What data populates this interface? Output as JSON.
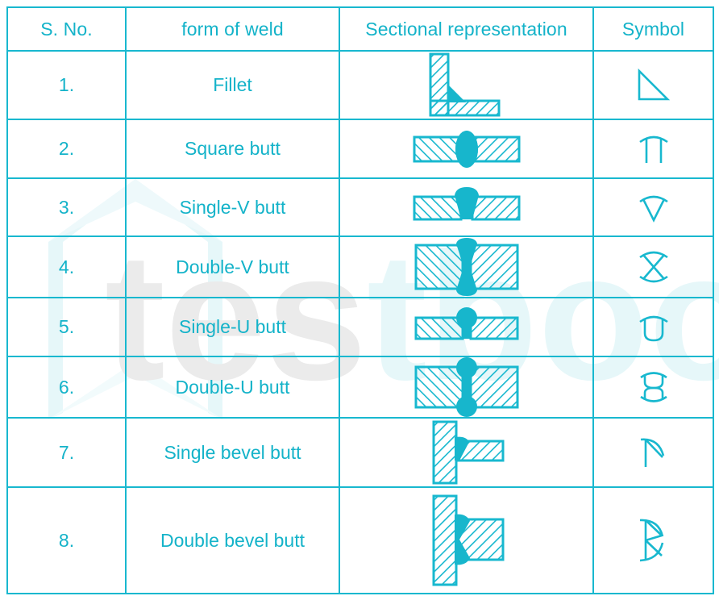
{
  "table": {
    "headers": [
      {
        "key": "sno",
        "label": "S. No."
      },
      {
        "key": "form",
        "label": "form of weld"
      },
      {
        "key": "sect",
        "label": "Sectional representation"
      },
      {
        "key": "sym",
        "label": "Symbol"
      }
    ],
    "rows": [
      {
        "sno": "1.",
        "form": "Fillet",
        "sectional": "fillet-weld-section",
        "symbol": "fillet-weld-symbol"
      },
      {
        "sno": "2.",
        "form": "Square butt",
        "sectional": "square-butt-section",
        "symbol": "square-butt-symbol"
      },
      {
        "sno": "3.",
        "form": "Single-V butt",
        "sectional": "single-v-butt-section",
        "symbol": "single-v-butt-symbol"
      },
      {
        "sno": "4.",
        "form": "Double-V butt",
        "sectional": "double-v-butt-section",
        "symbol": "double-v-butt-symbol"
      },
      {
        "sno": "5.",
        "form": "Single-U butt",
        "sectional": "single-u-butt-section",
        "symbol": "single-u-butt-symbol"
      },
      {
        "sno": "6.",
        "form": "Double-U butt",
        "sectional": "double-u-butt-section",
        "symbol": "double-u-butt-symbol"
      },
      {
        "sno": "7.",
        "form": "Single bevel butt",
        "sectional": "single-bevel-butt-section",
        "symbol": "single-bevel-butt-symbol"
      },
      {
        "sno": "8.",
        "form": "Double bevel butt",
        "sectional": "double-bevel-butt-section",
        "symbol": "double-bevel-butt-symbol"
      }
    ]
  },
  "watermark": {
    "text": "testbook",
    "gray": "#ebebeb",
    "teal": "#e6f7f9"
  },
  "colors": {
    "line": "#18b8cf",
    "text": "#14b3c9",
    "fill": "#17b6cc",
    "background": "#ffffff"
  }
}
